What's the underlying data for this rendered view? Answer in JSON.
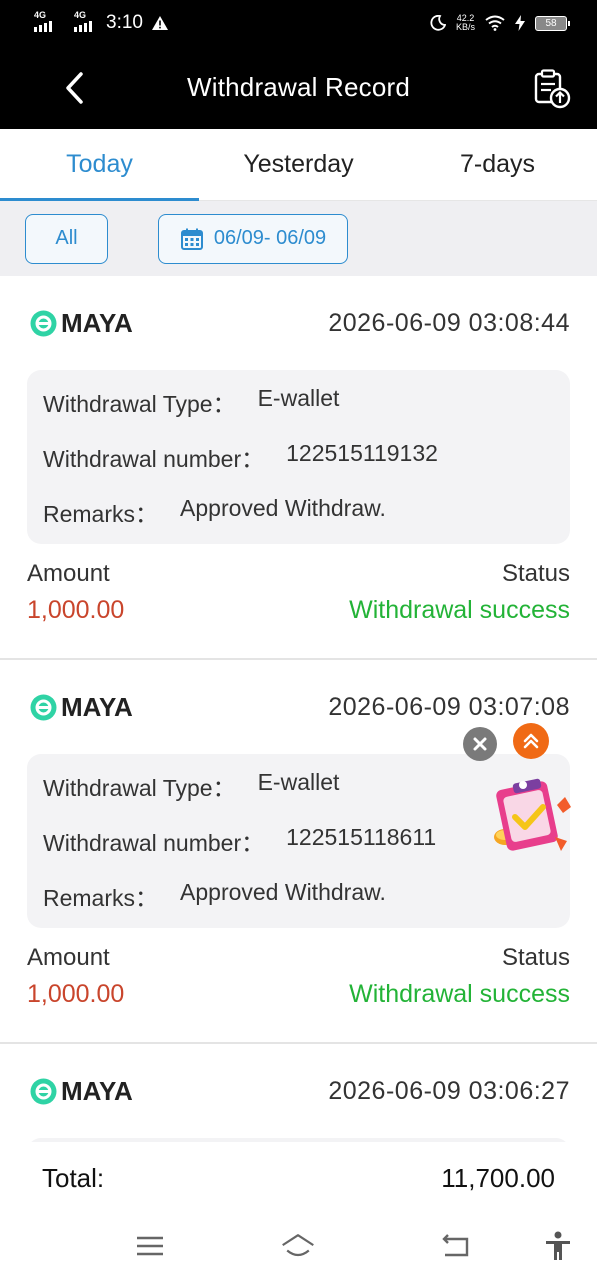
{
  "status_bar": {
    "net1": "4G",
    "net2": "4G",
    "time": "3:10",
    "speed_value": "42.2",
    "speed_unit": "KB/s",
    "battery": "58"
  },
  "header": {
    "title": "Withdrawal Record",
    "back_icon": "chevron-left-icon",
    "action_icon": "clipboard-upload-icon"
  },
  "tabs": [
    {
      "label": "Today",
      "active": true
    },
    {
      "label": "Yesterday",
      "active": false
    },
    {
      "label": "7-days",
      "active": false
    }
  ],
  "filters": {
    "all_label": "All",
    "date_range": "06/09- 06/09"
  },
  "records": [
    {
      "brand": "MAYA",
      "time": "2026-06-09 03:08:44",
      "type_label": "Withdrawal Type：",
      "type_value": "E-wallet",
      "number_label": "Withdrawal number：",
      "number_value": "122515119132",
      "remarks_label": "Remarks：",
      "remarks_value": "Approved Withdraw.",
      "amount_label": "Amount",
      "amount": "1,000.00",
      "status_label": "Status",
      "status": "Withdrawal success"
    },
    {
      "brand": "MAYA",
      "time": "2026-06-09 03:07:08",
      "type_label": "Withdrawal Type：",
      "type_value": "E-wallet",
      "number_label": "Withdrawal number：",
      "number_value": "122515118611",
      "remarks_label": "Remarks：",
      "remarks_value": "Approved Withdraw.",
      "amount_label": "Amount",
      "amount": "1,000.00",
      "status_label": "Status",
      "status": "Withdrawal success"
    },
    {
      "brand": "MAYA",
      "time": "2026-06-09 03:06:27"
    }
  ],
  "total": {
    "label": "Total:",
    "value": "11,700.00"
  },
  "colors": {
    "accent": "#2d8ccf",
    "amount": "#c9452c",
    "success": "#23b337",
    "maya": "#2fd3a5"
  }
}
